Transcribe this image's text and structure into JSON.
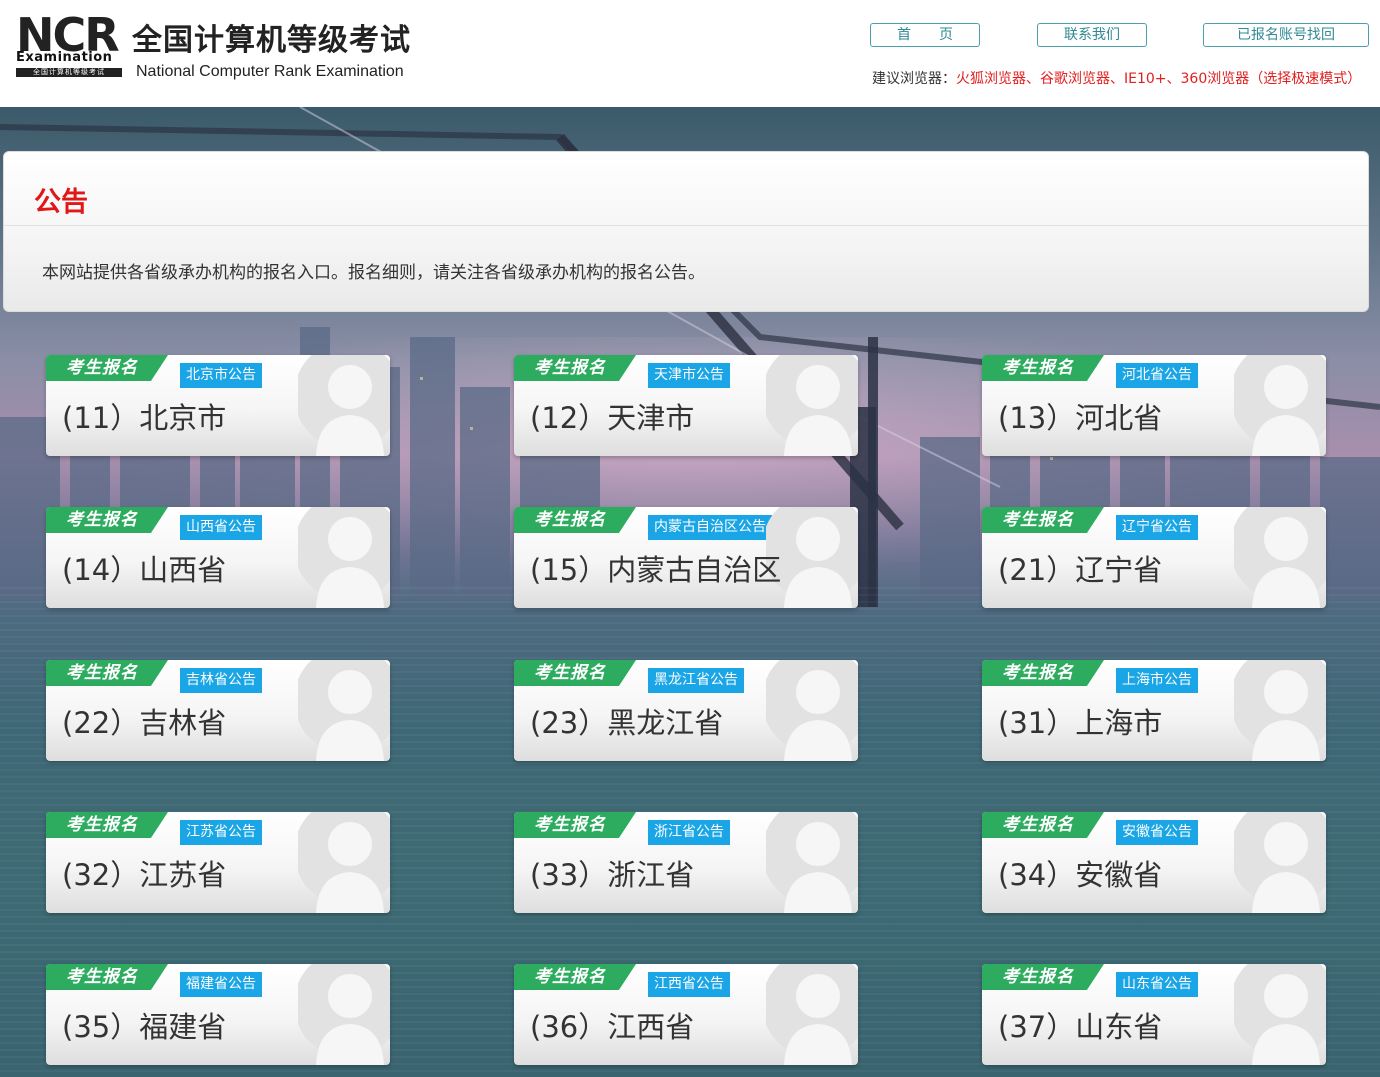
{
  "header": {
    "logo": {
      "mark_text": "NCR",
      "mark_sub": "Examination",
      "mark_bar": "全国计算机等级考试",
      "title_cn": "全国计算机等级考试",
      "title_en": "National Computer Rank Examination"
    },
    "nav": {
      "home": "首　　页",
      "contact": "联系我们",
      "account_recovery": "已报名账号找回"
    },
    "browser_tip": {
      "label": "建议浏览器：",
      "value": "火狐浏览器、谷歌浏览器、IE10+、360浏览器（选择极速模式）"
    }
  },
  "notice": {
    "title": "公告",
    "text": "本网站提供各省级承办机构的报名入口。报名细则，请关注各省级承办机构的报名公告。"
  },
  "cards": [
    {
      "tag": "考生报名",
      "announce": "北京市公告",
      "name": "(11）北京市"
    },
    {
      "tag": "考生报名",
      "announce": "天津市公告",
      "name": "(12）天津市"
    },
    {
      "tag": "考生报名",
      "announce": "河北省公告",
      "name": "(13）河北省"
    },
    {
      "tag": "考生报名",
      "announce": "山西省公告",
      "name": "(14）山西省"
    },
    {
      "tag": "考生报名",
      "announce": "内蒙古自治区公告",
      "name": "(15）内蒙古自治区"
    },
    {
      "tag": "考生报名",
      "announce": "辽宁省公告",
      "name": "(21）辽宁省"
    },
    {
      "tag": "考生报名",
      "announce": "吉林省公告",
      "name": "(22）吉林省"
    },
    {
      "tag": "考生报名",
      "announce": "黑龙江省公告",
      "name": "(23）黑龙江省"
    },
    {
      "tag": "考生报名",
      "announce": "上海市公告",
      "name": "(31）上海市"
    },
    {
      "tag": "考生报名",
      "announce": "江苏省公告",
      "name": "(32）江苏省"
    },
    {
      "tag": "考生报名",
      "announce": "浙江省公告",
      "name": "(33）浙江省"
    },
    {
      "tag": "考生报名",
      "announce": "安徽省公告",
      "name": "(34）安徽省"
    },
    {
      "tag": "考生报名",
      "announce": "福建省公告",
      "name": "(35）福建省"
    },
    {
      "tag": "考生报名",
      "announce": "江西省公告",
      "name": "(36）江西省"
    },
    {
      "tag": "考生报名",
      "announce": "山东省公告",
      "name": "(37）山东省"
    }
  ],
  "colors": {
    "accent_red": "#e01818",
    "tag_green": "#2dab5f",
    "tag_blue": "#1aa6e6",
    "nav_border": "#4aa0a8"
  }
}
